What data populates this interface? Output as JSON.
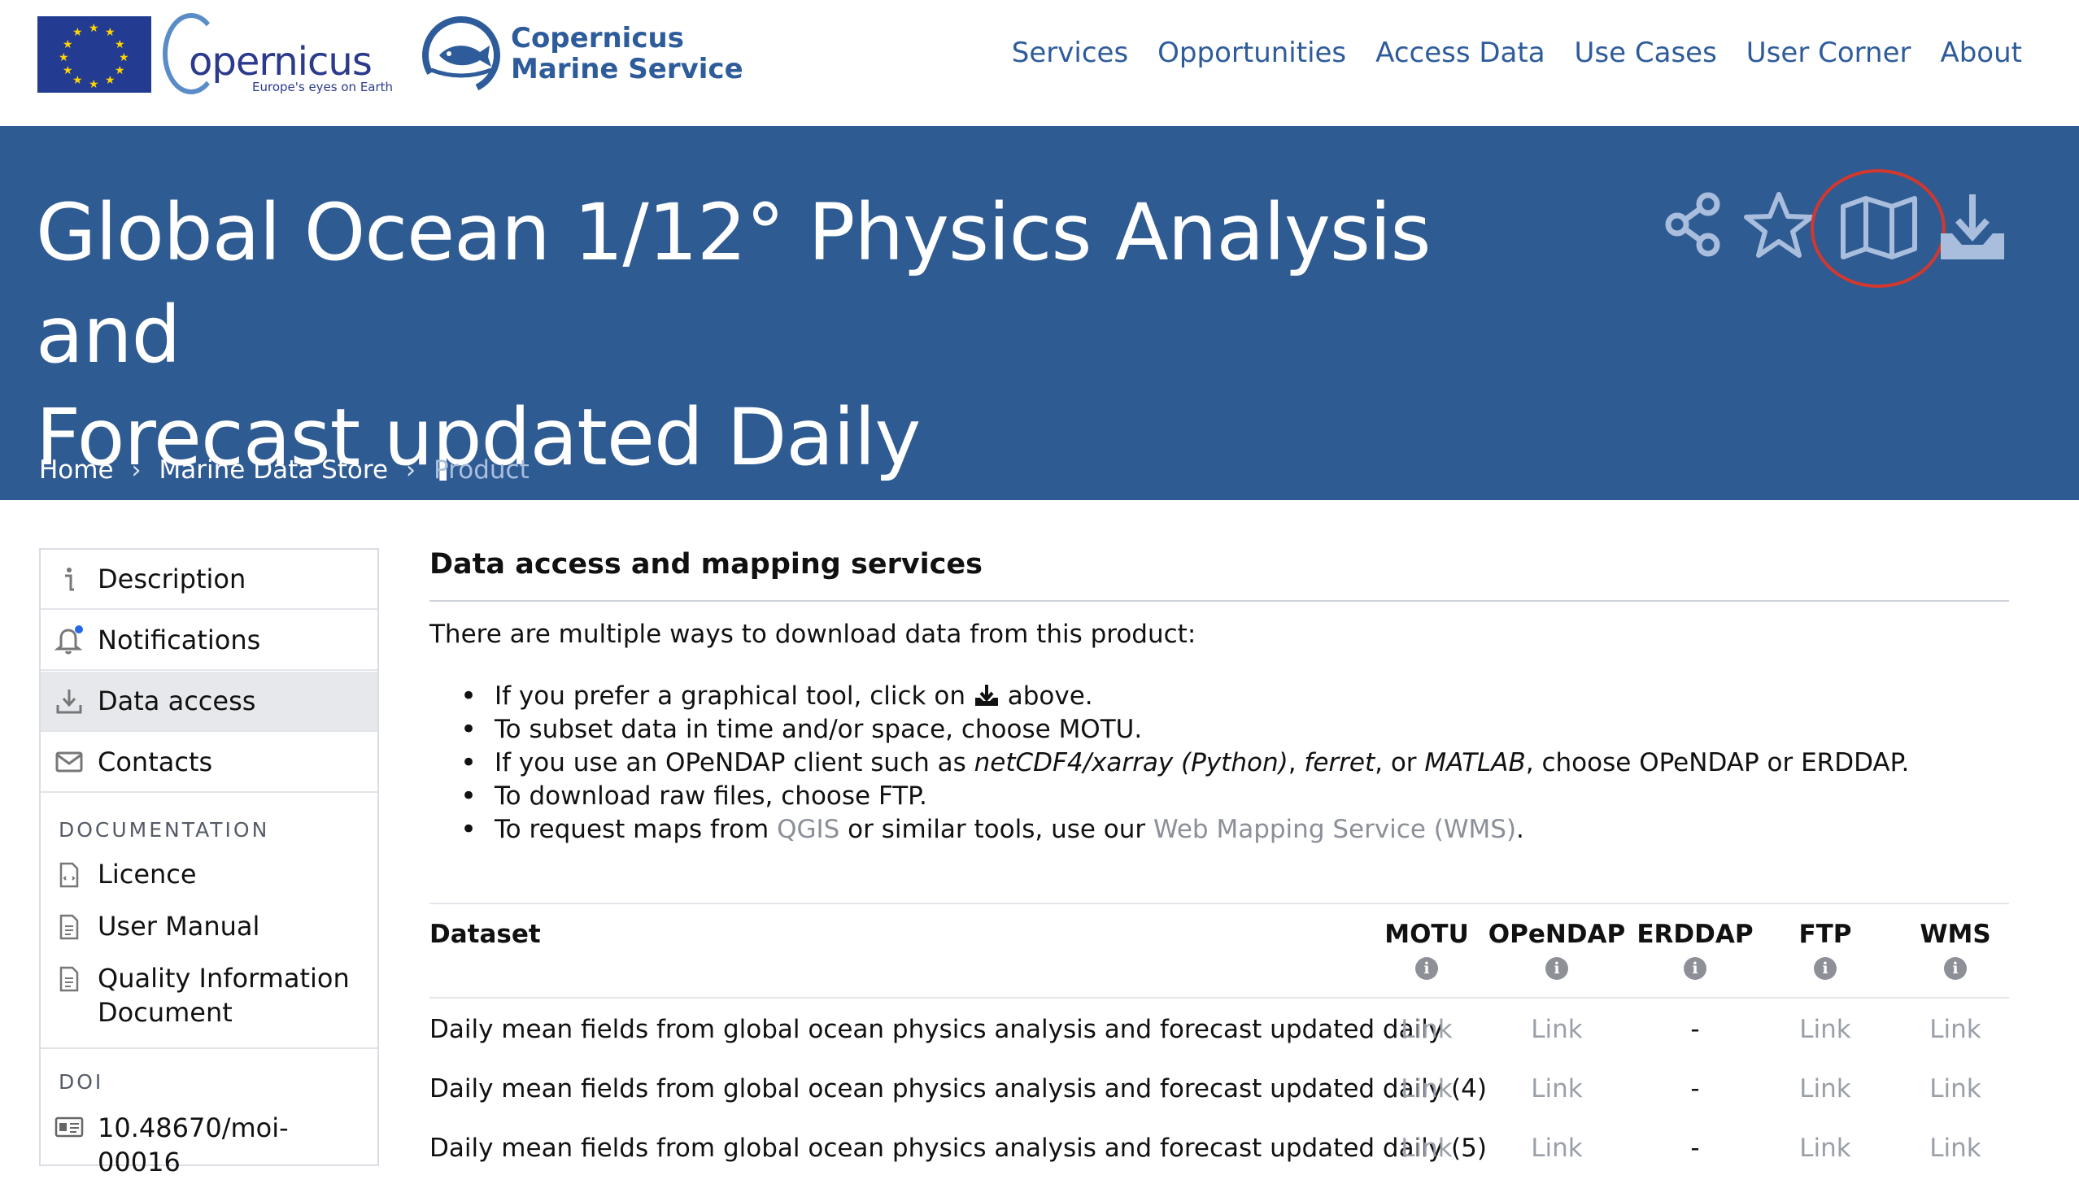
{
  "header": {
    "copernicus_wordmark": "opernicus",
    "copernicus_tagline": "Europe's eyes on Earth",
    "cms_title_line1": "Copernicus",
    "cms_title_line2": "Marine Service",
    "nav": [
      "Services",
      "Opportunities",
      "Access Data",
      "Use Cases",
      "User Corner",
      "About"
    ]
  },
  "banner": {
    "title_line1": "Global Ocean 1/12° Physics Analysis and",
    "title_line2": "Forecast updated Daily",
    "actions": [
      "share-icon",
      "star-icon",
      "map-icon",
      "download-icon"
    ],
    "highlight_color": "#d2382e",
    "breadcrumb": [
      "Home",
      "Marine Data Store",
      "Product"
    ]
  },
  "sidebar": {
    "items": [
      {
        "label": "Description",
        "icon": "info-icon"
      },
      {
        "label": "Notifications",
        "icon": "bell-icon"
      },
      {
        "label": "Data access",
        "icon": "download-icon"
      },
      {
        "label": "Contacts",
        "icon": "envelope-icon"
      }
    ],
    "documentation_heading": "DOCUMENTATION",
    "docs": [
      {
        "label": "Licence",
        "icon": "document-icon"
      },
      {
        "label": "User Manual",
        "icon": "document-icon"
      },
      {
        "label": "Quality Information Document",
        "icon": "document-icon"
      }
    ],
    "doi_heading": "DOI",
    "doi_value": "10.48670/moi-00016"
  },
  "main": {
    "section_title": "Data access and mapping services",
    "intro": "There are multiple ways to download data from this product:",
    "bullets": {
      "b1_pre": "If you prefer a graphical tool, click on",
      "b1_post": "above.",
      "b2": "To subset data in time and/or space, choose MOTU.",
      "b3_pre": "If you use an OPeNDAP client such as ",
      "b3_em1": "netCDF4/xarray (Python)",
      "b3_sep1": ", ",
      "b3_em2": "ferret",
      "b3_sep2": ", or ",
      "b3_em3": "MATLAB",
      "b3_post": ", choose OPeNDAP or ERDDAP.",
      "b4": "To download raw files, choose FTP.",
      "b5_pre": "To request maps from ",
      "b5_link1": "QGIS",
      "b5_mid": " or similar tools, use our ",
      "b5_link2": "Web Mapping Service (WMS)",
      "b5_post": "."
    },
    "table": {
      "dataset_header": "Dataset",
      "columns": [
        "MOTU",
        "OPeNDAP",
        "ERDDAP",
        "FTP",
        "WMS"
      ],
      "info_glyph": "i",
      "rows": [
        {
          "name": "Daily mean fields from global ocean physics analysis and forecast updated daily",
          "cells": [
            "Link",
            "Link",
            "-",
            "Link",
            "Link"
          ]
        },
        {
          "name": "Daily mean fields from global ocean physics analysis and forecast updated daily (4)",
          "cells": [
            "Link",
            "Link",
            "-",
            "Link",
            "Link"
          ]
        },
        {
          "name": "Daily mean fields from global ocean physics analysis and forecast updated daily (5)",
          "cells": [
            "Link",
            "Link",
            "-",
            "Link",
            "Link"
          ]
        }
      ]
    }
  }
}
